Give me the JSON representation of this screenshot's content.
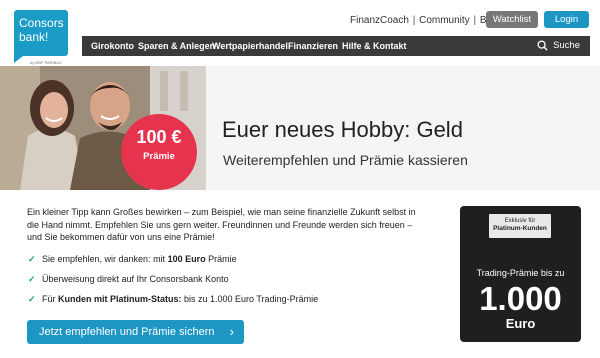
{
  "header": {
    "logo_line1": "Consors",
    "logo_line2": "bank!",
    "logo_sub": "by BNP PARIBAS",
    "top_links": [
      "FinanzCoach",
      "Community",
      "Blog"
    ],
    "watchlist_label": "Watchlist",
    "login_label": "Login"
  },
  "nav": {
    "items": [
      "Girokonto",
      "Sparen & Anlegen",
      "Wertpapierhandel",
      "Finanzieren",
      "Hilfe & Kontakt"
    ],
    "search_label": "Suche"
  },
  "hero": {
    "badge_amount": "100 €",
    "badge_label": "Prämie",
    "title": "Euer neues Hobby: Geld",
    "subtitle": "Weiterempfehlen und Prämie kassieren"
  },
  "content": {
    "intro_lines": [
      "Ein kleiner Tipp kann Großes bewirken – zum Beispiel, wie man seine finanzielle Zukunft selbst in",
      "die Hand nimmt. Empfehlen Sie uns gern weiter. Freundinnen und Freunde werden sich freuen –",
      "und Sie bekommen dafür von uns eine Prämie!"
    ],
    "bullets": [
      {
        "pre": "Sie empfehlen, wir danken: mit ",
        "bold": "100 Euro",
        "post": " Prämie"
      },
      {
        "pre": "Überweisung direkt auf Ihr Consorsbank Konto",
        "bold": "",
        "post": ""
      },
      {
        "pre": "Für ",
        "bold": "Kunden mit Platinum-Status:",
        "post": " bis zu 1.000 Euro Trading-Prämie"
      }
    ],
    "cta_label": "Jetzt empfehlen und Prämie sichern"
  },
  "card": {
    "tag_line1": "Exklusiv für",
    "tag_line2": "Platinum-Kunden",
    "label": "Trading-Prämie bis zu",
    "amount": "1.000",
    "currency": "Euro"
  },
  "colors": {
    "brand_blue": "#1e96c4",
    "badge_red": "#e6344f",
    "nav_dark": "#3a3a3a",
    "check_green": "#2ca36b"
  }
}
